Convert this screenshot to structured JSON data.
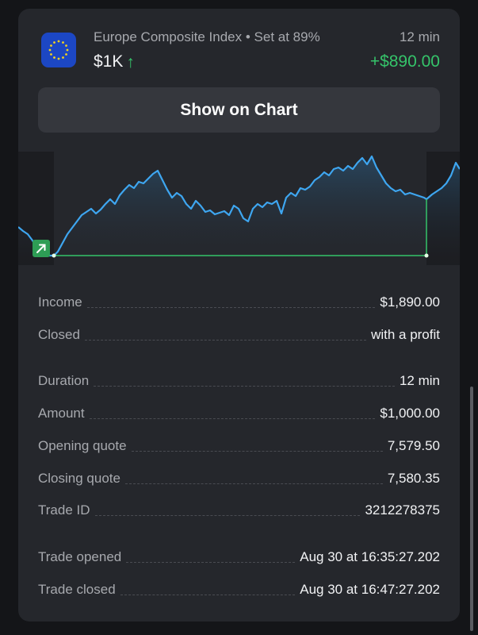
{
  "trade": {
    "asset": "Europe Composite Index",
    "separator": "•",
    "setting": "Set at 89%",
    "duration_header": "12 min",
    "amount": "$1K",
    "profit": "+$890.00"
  },
  "actions": {
    "show_on_chart": "Show on Chart"
  },
  "colors": {
    "accent_green": "#35c46a",
    "line_blue": "#3ea6f0",
    "card_bg": "#25272c",
    "flag_blue": "#1c47c4",
    "flag_stars": "#f3d21f"
  },
  "details": [
    {
      "label": "Income",
      "value": "$1,890.00"
    },
    {
      "label": "Closed",
      "value": "with a profit"
    },
    {
      "label": "Duration",
      "value": "12 min"
    },
    {
      "label": "Amount",
      "value": "$1,000.00"
    },
    {
      "label": "Opening quote",
      "value": "7,579.50"
    },
    {
      "label": "Closing quote",
      "value": "7,580.35"
    },
    {
      "label": "Trade ID",
      "value": "3212278375"
    },
    {
      "label": "Trade opened",
      "value": "Aug 30 at 16:35:27.202"
    },
    {
      "label": "Trade closed",
      "value": "Aug 30 at 16:47:27.202"
    }
  ],
  "icons": {
    "flag": "eu-flag-icon",
    "direction": "arrow-up-icon",
    "entry_marker": "entry-arrow-icon"
  }
}
